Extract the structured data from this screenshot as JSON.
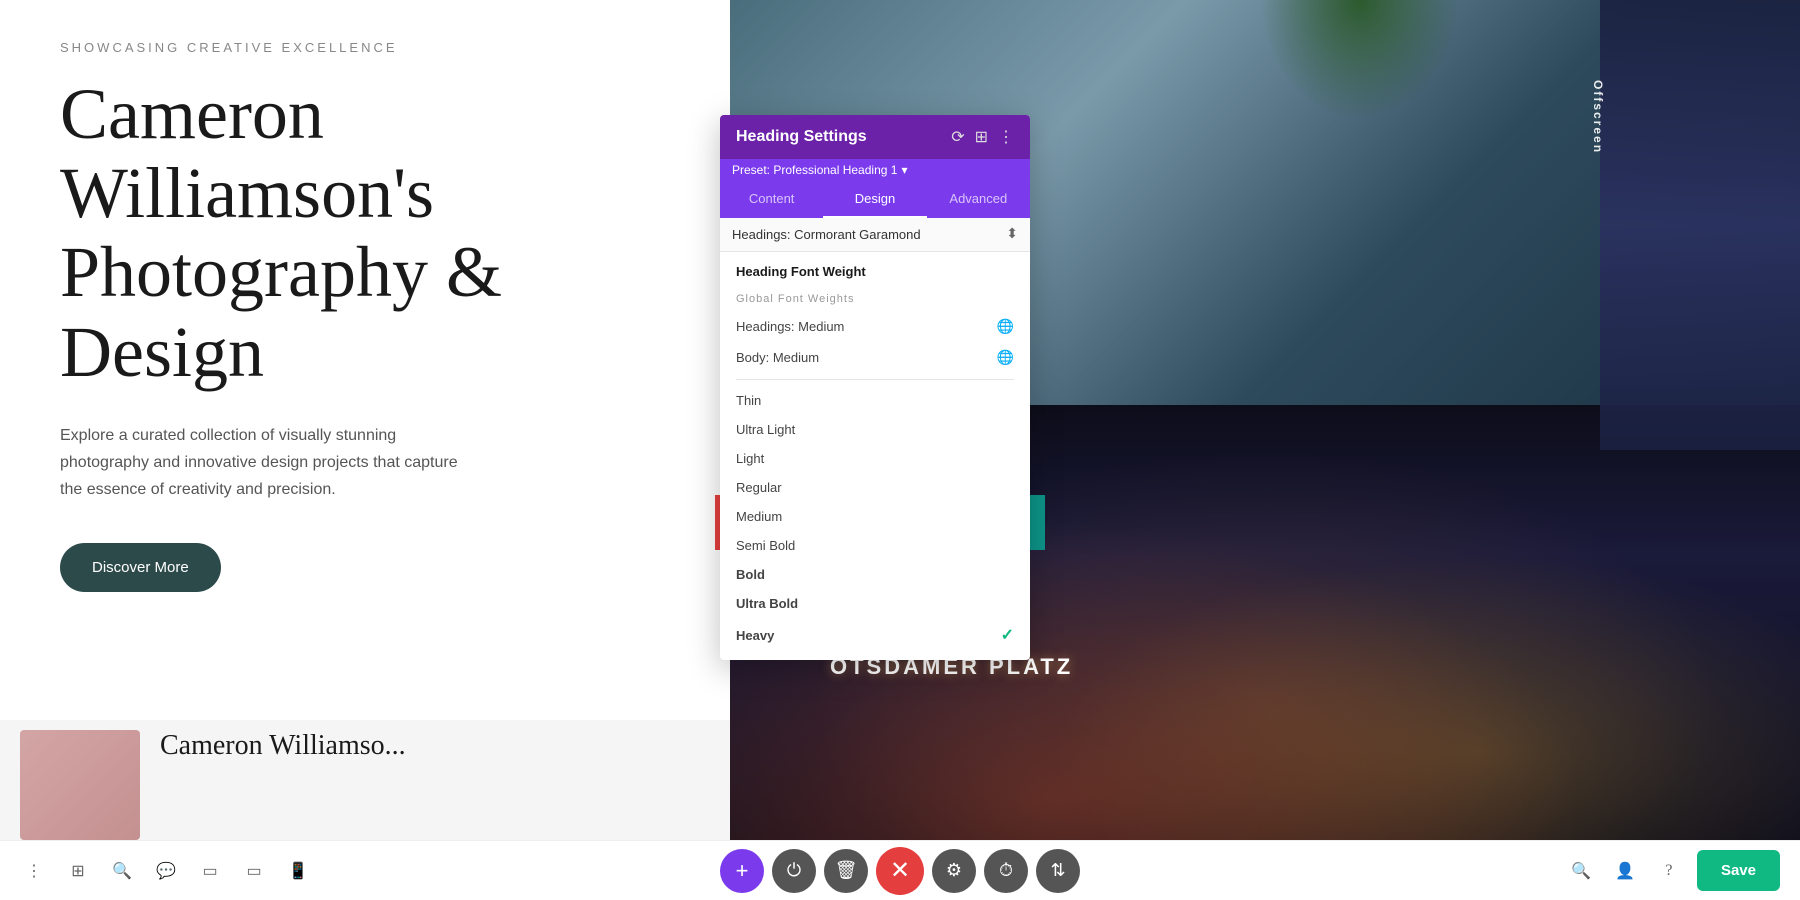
{
  "page": {
    "subtitle": "SHOWCASING CREATIVE EXCELLENCE",
    "title_line1": "Cameron",
    "title_line2": "Williamson's",
    "title_line3": "Photography &",
    "title_line4": "Design",
    "description": "Explore a curated collection of visually stunning photography and innovative design projects that capture the essence of creativity and precision.",
    "cta_button": "Discover More",
    "offscreen_label": "Offscreen",
    "sign_text": "OTSDAMER PLATZ"
  },
  "panel": {
    "title": "Heading Settings",
    "preset_label": "Preset: Professional Heading 1",
    "preset_arrow": "▾",
    "tabs": [
      {
        "id": "content",
        "label": "Content",
        "active": false
      },
      {
        "id": "design",
        "label": "Design",
        "active": true
      },
      {
        "id": "advanced",
        "label": "Advanced",
        "active": false
      }
    ],
    "font_selector_label": "Headings: Cormorant Garamond",
    "section_title": "Heading Font Weight",
    "group_label": "Global Font Weights",
    "font_items": [
      {
        "id": "headings-medium",
        "label": "Headings: Medium",
        "has_globe": true,
        "bold": false,
        "selected": false
      },
      {
        "id": "body-medium",
        "label": "Body: Medium",
        "has_globe": true,
        "bold": false,
        "selected": false
      },
      {
        "id": "divider1",
        "type": "divider"
      },
      {
        "id": "thin",
        "label": "Thin",
        "has_globe": false,
        "bold": false,
        "selected": false
      },
      {
        "id": "ultra-light",
        "label": "Ultra Light",
        "has_globe": false,
        "bold": false,
        "selected": false
      },
      {
        "id": "light",
        "label": "Light",
        "has_globe": false,
        "bold": false,
        "selected": false
      },
      {
        "id": "regular",
        "label": "Regular",
        "has_globe": false,
        "bold": false,
        "selected": false
      },
      {
        "id": "medium",
        "label": "Medium",
        "has_globe": false,
        "bold": false,
        "selected": false
      },
      {
        "id": "semi-bold",
        "label": "Semi Bold",
        "has_globe": false,
        "bold": false,
        "selected": false
      },
      {
        "id": "bold",
        "label": "Bold",
        "has_globe": false,
        "bold": true,
        "selected": false
      },
      {
        "id": "ultra-bold",
        "label": "Ultra Bold",
        "has_globe": false,
        "bold": true,
        "selected": false
      },
      {
        "id": "heavy",
        "label": "Heavy",
        "has_globe": false,
        "bold": true,
        "selected": true
      }
    ]
  },
  "toolbar": {
    "left_icons": [
      "⋮",
      "⊞",
      "🔍",
      "💬",
      "▭",
      "📱"
    ],
    "center_buttons": [
      "+",
      "⏻",
      "🗑",
      "✕",
      "⚙",
      "⏱",
      "⇅"
    ],
    "right_icons": [
      "🔍",
      "👤",
      "?"
    ],
    "save_label": "Save"
  },
  "preview": {
    "title": "Cameron Williamso..."
  }
}
